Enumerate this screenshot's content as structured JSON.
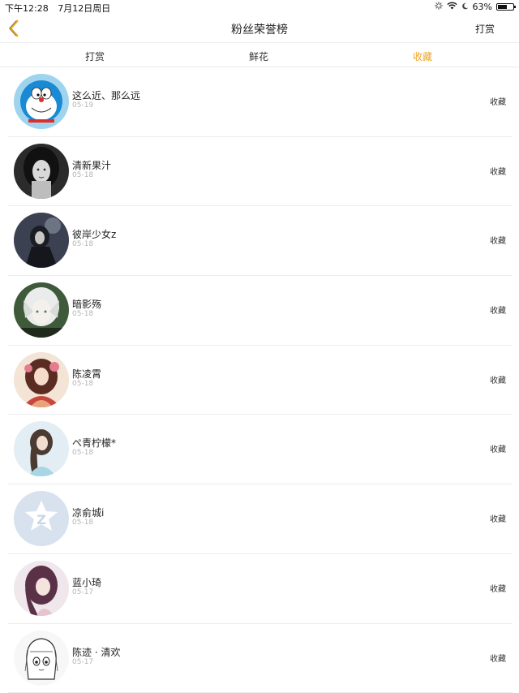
{
  "status_bar": {
    "time": "下午12:28",
    "date": "7月12日周日",
    "battery": "63%",
    "battery_level": 0.63
  },
  "nav": {
    "title": "粉丝荣誉榜",
    "right_label": "打赏",
    "accent_color": "#e8a51f"
  },
  "tabs": [
    {
      "label": "打赏",
      "active": false
    },
    {
      "label": "鲜花",
      "active": false
    },
    {
      "label": "收藏",
      "active": true
    }
  ],
  "list": [
    {
      "name": "这么近、那么远",
      "date": "05-19",
      "action": "收藏"
    },
    {
      "name": "清新果汁",
      "date": "05-18",
      "action": "收藏"
    },
    {
      "name": "彼岸少女z",
      "date": "05-18",
      "action": "收藏"
    },
    {
      "name": "暗影殇",
      "date": "05-18",
      "action": "收藏"
    },
    {
      "name": "陈凌霄",
      "date": "05-18",
      "action": "收藏"
    },
    {
      "name": "ぺ青柠檬*",
      "date": "05-18",
      "action": "收藏"
    },
    {
      "name": "凉俞城i",
      "date": "05-18",
      "action": "收藏"
    },
    {
      "name": "蓝小琦",
      "date": "05-17",
      "action": "收藏"
    },
    {
      "name": "陈迹 · 清欢",
      "date": "05-17",
      "action": "收藏"
    }
  ]
}
